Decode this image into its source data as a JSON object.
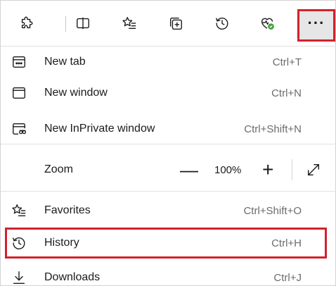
{
  "toolbar": {
    "icons": [
      "extensions-icon",
      "split-screen-icon",
      "favorites-icon",
      "collections-icon",
      "history-icon",
      "browser-essentials-icon"
    ],
    "more_label": "···"
  },
  "menu": {
    "items": [
      {
        "label": "New tab",
        "shortcut": "Ctrl+T",
        "icon": "new-tab-icon"
      },
      {
        "label": "New window",
        "shortcut": "Ctrl+N",
        "icon": "new-window-icon"
      },
      {
        "label": "New InPrivate window",
        "shortcut": "Ctrl+Shift+N",
        "icon": "inprivate-icon"
      },
      {
        "label": "Favorites",
        "shortcut": "Ctrl+Shift+O",
        "icon": "favorites-icon"
      },
      {
        "label": "History",
        "shortcut": "Ctrl+H",
        "icon": "history-icon"
      },
      {
        "label": "Downloads",
        "shortcut": "Ctrl+J",
        "icon": "download-icon"
      }
    ],
    "zoom": {
      "label": "Zoom",
      "minus": "—",
      "value": "100%",
      "plus": "+"
    }
  },
  "colors": {
    "highlight_border": "#d3212d",
    "accent_green": "#3fa33a",
    "shortcut_text": "#6b6b6b"
  }
}
